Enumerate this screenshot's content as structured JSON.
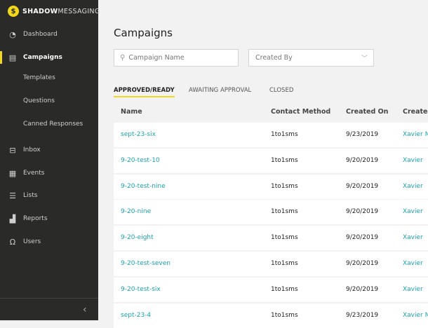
{
  "brand": {
    "bold": "SHADOW",
    "light": "MESSAGING",
    "coin": "$"
  },
  "sidebar": {
    "items": [
      {
        "label": "Dashboard",
        "icon": "gauge-icon"
      },
      {
        "label": "Campaigns",
        "icon": "campaigns-icon",
        "active": true
      },
      {
        "label": "Templates"
      },
      {
        "label": "Questions"
      },
      {
        "label": "Canned Responses"
      },
      {
        "label": "Inbox",
        "icon": "inbox-icon"
      },
      {
        "label": "Events",
        "icon": "calendar-icon"
      },
      {
        "label": "Lists",
        "icon": "list-icon"
      },
      {
        "label": "Reports",
        "icon": "bar-chart-icon"
      },
      {
        "label": "Users",
        "icon": "user-icon"
      }
    ],
    "collapse": "‹"
  },
  "main": {
    "title": "Campaigns",
    "search": {
      "placeholder": "Campaign Name"
    },
    "created_by": {
      "placeholder": "Created By"
    },
    "tabs": [
      "APPROVED/READY",
      "AWAITING APPROVAL",
      "CLOSED"
    ],
    "columns": [
      "Name",
      "Contact Method",
      "Created On",
      "Created"
    ],
    "rows": [
      [
        "sept-23-six",
        "1to1sms",
        "9/23/2019",
        "Xavier M"
      ],
      [
        "9-20-test-10",
        "1to1sms",
        "9/20/2019",
        "Xavier"
      ],
      [
        "9-20-test-nine",
        "1to1sms",
        "9/20/2019",
        "Xavier"
      ],
      [
        "9-20-nine",
        "1to1sms",
        "9/20/2019",
        "Xavier"
      ],
      [
        "9-20-eight",
        "1to1sms",
        "9/20/2019",
        "Xavier"
      ],
      [
        "9-20-test-seven",
        "1to1sms",
        "9/20/2019",
        "Xavier"
      ],
      [
        "9-20-test-six",
        "1to1sms",
        "9/20/2019",
        "Xavier"
      ],
      [
        "sept-23-4",
        "1to1sms",
        "9/23/2019",
        "Xavier M"
      ]
    ]
  },
  "colors": {
    "accent": "#f2d81a",
    "link": "#1aa3b0",
    "sidebar": "#2a2a28"
  }
}
